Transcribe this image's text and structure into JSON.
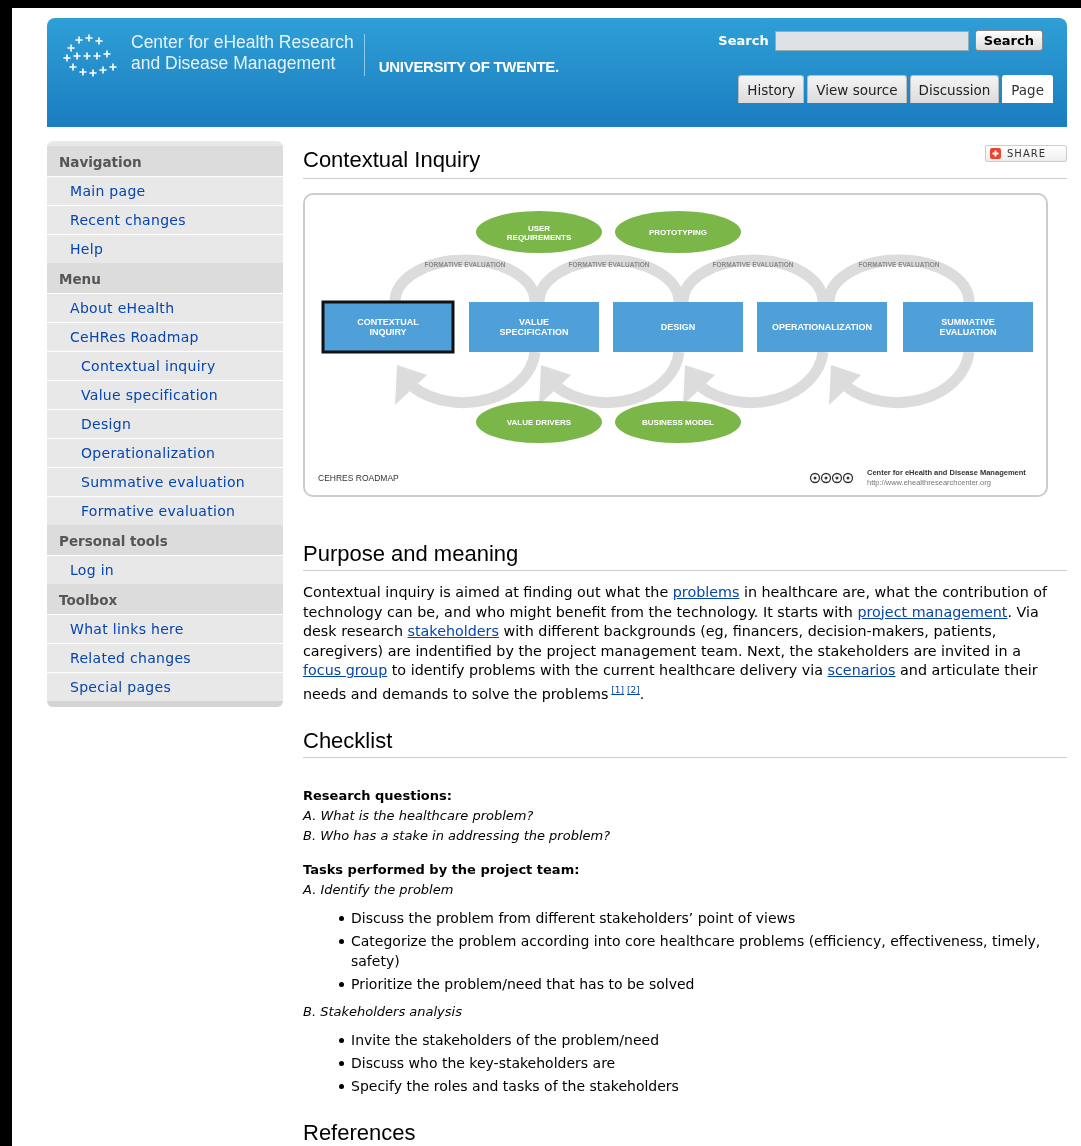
{
  "header": {
    "org_line_1": "Center for eHealth Research",
    "org_line_2": "and Disease Management",
    "university": "UNIVERSITY OF TWENTE.",
    "search_label": "Search",
    "search_button": "Search",
    "tabs": [
      {
        "label": "History",
        "selected": false
      },
      {
        "label": "View source",
        "selected": false
      },
      {
        "label": "Discussion",
        "selected": false
      },
      {
        "label": "Page",
        "selected": true
      }
    ]
  },
  "sidebar": [
    {
      "heading": "Navigation",
      "items": [
        {
          "label": "Main page"
        },
        {
          "label": "Recent changes"
        },
        {
          "label": "Help"
        }
      ]
    },
    {
      "heading": "Menu",
      "items": [
        {
          "label": "About eHealth"
        },
        {
          "label": "CeHRes Roadmap",
          "children": [
            {
              "label": "Contextual inquiry"
            },
            {
              "label": "Value specification"
            },
            {
              "label": "Design"
            },
            {
              "label": "Operationalization"
            },
            {
              "label": "Summative evaluation"
            },
            {
              "label": "Formative evaluation"
            }
          ]
        }
      ]
    },
    {
      "heading": "Personal tools",
      "items": [
        {
          "label": "Log in"
        }
      ]
    },
    {
      "heading": "Toolbox",
      "items": [
        {
          "label": "What links here"
        },
        {
          "label": "Related changes"
        },
        {
          "label": "Special pages"
        }
      ]
    }
  ],
  "page": {
    "title": "Contextual Inquiry",
    "share": "SHARE",
    "figure": {
      "stages": [
        {
          "label": "CONTEXTUAL INQUIRY",
          "selected": true
        },
        {
          "label": "VALUE SPECIFICATION",
          "selected": false
        },
        {
          "label": "DESIGN",
          "selected": false
        },
        {
          "label": "OPERATIONALIZATION",
          "selected": false
        },
        {
          "label": "SUMMATIVE EVALUATION",
          "selected": false
        }
      ],
      "loop_labels": [
        "FORMATIVE EVALUATION",
        "FORMATIVE EVALUATION",
        "FORMATIVE EVALUATION",
        "FORMATIVE EVALUATION"
      ],
      "top_ovals": [
        "USER REQUIREMENTS",
        "PROTOTYPING"
      ],
      "bottom_ovals": [
        "VALUE DRIVERS",
        "BUSINESS MODEL"
      ],
      "caption": "CEHRES ROADMAP",
      "credit_name": "Center for eHealth and Disease Management",
      "credit_url": "http://www.ehealthresearchcenter.org"
    },
    "sections": [
      {
        "heading": "Purpose and meaning",
        "paragraph": [
          {
            "kind": "text",
            "text": "Contextual inquiry is aimed at finding out what the "
          },
          {
            "kind": "link",
            "text": "problems"
          },
          {
            "kind": "text",
            "text": " in healthcare are, what the contribution of technology can be, and who might benefit from the technology. It starts with "
          },
          {
            "kind": "link",
            "text": "project management"
          },
          {
            "kind": "text",
            "text": ". Via desk research "
          },
          {
            "kind": "link",
            "text": "stakeholders"
          },
          {
            "kind": "text",
            "text": " with different backgrounds (eg, financers, decision-makers, patients, caregivers) are indentified by the project management team. Next, the stakeholders are invited in a "
          },
          {
            "kind": "link",
            "text": "focus group"
          },
          {
            "kind": "text",
            "text": " to identify problems with the current healthcare delivery via "
          },
          {
            "kind": "link",
            "text": "scenarios"
          },
          {
            "kind": "text",
            "text": " and articulate their needs and demands to solve the problems"
          },
          {
            "kind": "ref",
            "text": "[1]"
          },
          {
            "kind": "ref",
            "text": "[2]"
          },
          {
            "kind": "text",
            "text": "."
          }
        ]
      },
      {
        "heading": "Checklist",
        "blocks": [
          {
            "kind": "bold",
            "text": "Research questions:"
          },
          {
            "kind": "italic",
            "text": "A. What is the healthcare problem?"
          },
          {
            "kind": "italic",
            "text": "B. Who has a stake in addressing the problem?"
          },
          {
            "kind": "bold",
            "text": "Tasks performed by the project team:"
          },
          {
            "kind": "italic",
            "text": "A. Identify the problem"
          },
          {
            "kind": "bullets",
            "items": [
              "Discuss the problem from different stakeholders’ point of views",
              "Categorize the problem according into core healthcare problems (efficiency, effectiveness, timely, safety)",
              "Prioritize the problem/need that has to be solved"
            ]
          },
          {
            "kind": "italic",
            "text": "B. Stakeholders analysis"
          },
          {
            "kind": "bullets",
            "items": [
              "Invite the stakeholders of the problem/need",
              "Discuss who the key-stakeholders are",
              "Specify the roles and tasks of the stakeholders"
            ]
          }
        ]
      },
      {
        "heading": "References"
      }
    ]
  }
}
